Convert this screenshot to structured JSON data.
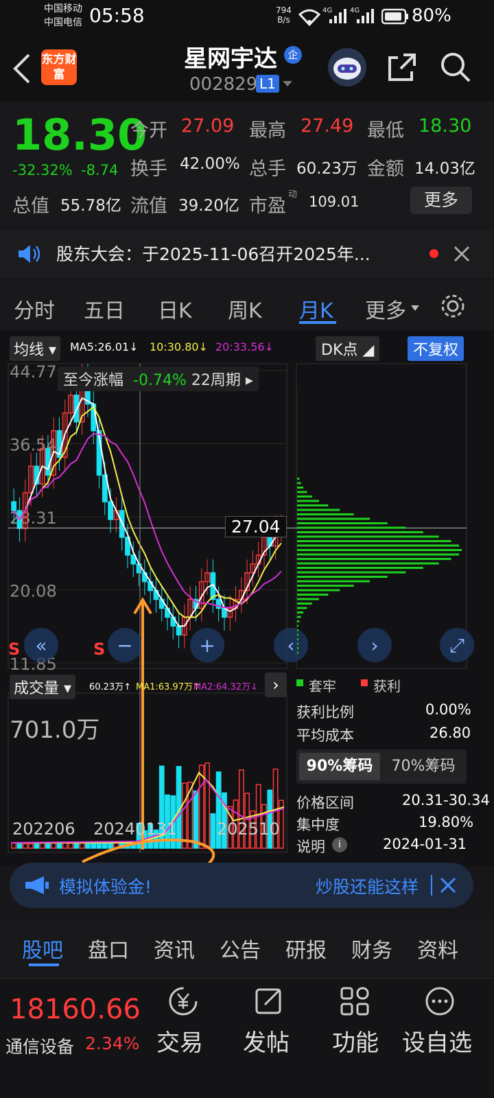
{
  "status": {
    "carrier1": "中国移动",
    "carrier2": "中国电信",
    "time": "05:58",
    "net_speed": "794",
    "net_unit": "B/s",
    "sig1": "4G",
    "sig2": "4G",
    "battery": "80%"
  },
  "header": {
    "app_logo": "东方财富",
    "stock_name": "星网宇达",
    "name_badge": "企",
    "code": "002829",
    "level": "L1"
  },
  "quote": {
    "price": "18.30",
    "change_pct": "-32.32%",
    "change": "-8.74",
    "fields": [
      {
        "label": "今开",
        "value": "27.09"
      },
      {
        "label": "最高",
        "value": "27.49"
      },
      {
        "label": "最低",
        "value": "18.30"
      },
      {
        "label": "换手",
        "value": "42.00%"
      },
      {
        "label": "总手",
        "value": "60.23万"
      },
      {
        "label": "金额",
        "value": "14.03亿"
      },
      {
        "label": "总值",
        "value": "55.78亿"
      },
      {
        "label": "流值",
        "value": "39.20亿"
      },
      {
        "label": "市盈",
        "value": "109.01"
      }
    ],
    "pe_sup": "动",
    "more": "更多"
  },
  "notice": {
    "text": "股东大会：于2025-11-06召开2025年..."
  },
  "tabs": {
    "items": [
      "分时",
      "五日",
      "日K",
      "周K",
      "月K",
      "更多"
    ],
    "active": 4
  },
  "chart": {
    "ma_label": "均线",
    "ma5": "MA5:26.01↓",
    "ma10": "10:30.80↓",
    "ma20": "20:33.56↓",
    "dk": "DK点",
    "fq": "不复权",
    "range_label": "至今涨幅",
    "range_val": "-0.74%",
    "range_period": "22周期",
    "y_ticks": [
      "44.77",
      "36.54",
      "28.31",
      "20.08",
      "11.85"
    ],
    "crosshair_price": "27.04",
    "s_marks": [
      "S",
      "S"
    ],
    "vol_label": "成交量",
    "vol_total": "60.23万↑",
    "vol_ma1": "MA1:63.97万↑",
    "vol_ma2": "MA2:64.32万↓",
    "vol_max": "701.0万",
    "dates": [
      "202206",
      "20240131",
      "202510"
    ],
    "colors": {
      "up": "#ff3b3b",
      "down": "#19e0f0",
      "ma5": "#ffffff",
      "ma10": "#f5f04a",
      "ma20": "#d62fd6"
    }
  },
  "chip": {
    "legend_trap": "套牢",
    "legend_profit": "获利",
    "rows": [
      {
        "label": "获利比例",
        "value": "0.00%"
      },
      {
        "label": "平均成本",
        "value": "26.80"
      }
    ],
    "tab90": "90%筹码",
    "tab70": "70%筹码",
    "rows2": [
      {
        "label": "价格区间",
        "value": "20.31-30.34"
      },
      {
        "label": "集中度",
        "value": "19.80%"
      },
      {
        "label": "说明",
        "value": "2024-01-31"
      }
    ]
  },
  "promo": {
    "left": "模拟体验金!",
    "right": "炒股还能这样"
  },
  "bottom_tabs": {
    "items": [
      "股吧",
      "盘口",
      "资讯",
      "公告",
      "研报",
      "财务",
      "资料"
    ],
    "active": 0
  },
  "footer": {
    "index_val": "18160.66",
    "index_name": "通信设备",
    "index_pct": "2.34%",
    "actions": [
      "交易",
      "发帖",
      "功能",
      "设自选"
    ]
  }
}
